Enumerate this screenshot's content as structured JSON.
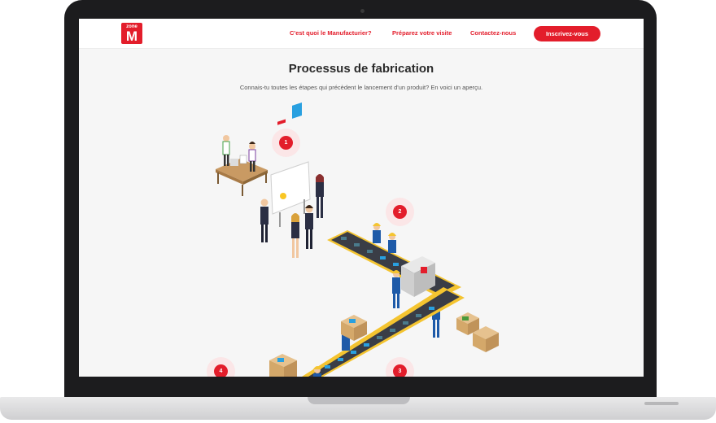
{
  "header": {
    "logo": {
      "top": "zone",
      "letter": "M"
    },
    "nav": [
      "C'est quoi le Manufacturier?",
      "Préparez votre visite",
      "Contactez-nous"
    ],
    "cta": "Inscrivez-vous"
  },
  "main": {
    "title": "Processus de fabrication",
    "subtitle": "Connais-tu toutes les étapes qui précèdent le lancement d'un produit? En voici un aperçu.",
    "steps": [
      "1",
      "2",
      "3",
      "4"
    ]
  },
  "colors": {
    "accent": "#e31d2b",
    "bezel": "#1c1c1e",
    "screen_bg": "#f6f6f6"
  }
}
